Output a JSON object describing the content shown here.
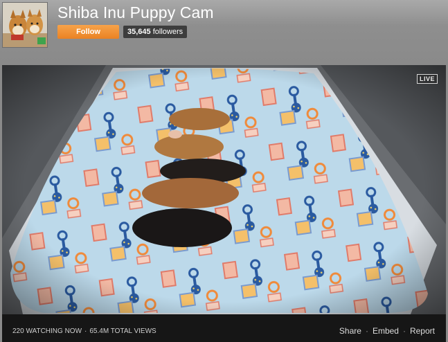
{
  "channel": {
    "title": "Shiba Inu Puppy Cam",
    "follow_label": "Follow",
    "followers_count": "35,645",
    "followers_label": "followers"
  },
  "player": {
    "live_badge": "LIVE"
  },
  "footer": {
    "watching": "220 WATCHING NOW",
    "total_views": "65.4M TOTAL VIEWS",
    "share_label": "Share",
    "embed_label": "Embed",
    "report_label": "Report"
  },
  "colors": {
    "follow_button": "#f08a2c",
    "header_bg": "#8a8a8a",
    "footer_bg": "#161616"
  }
}
